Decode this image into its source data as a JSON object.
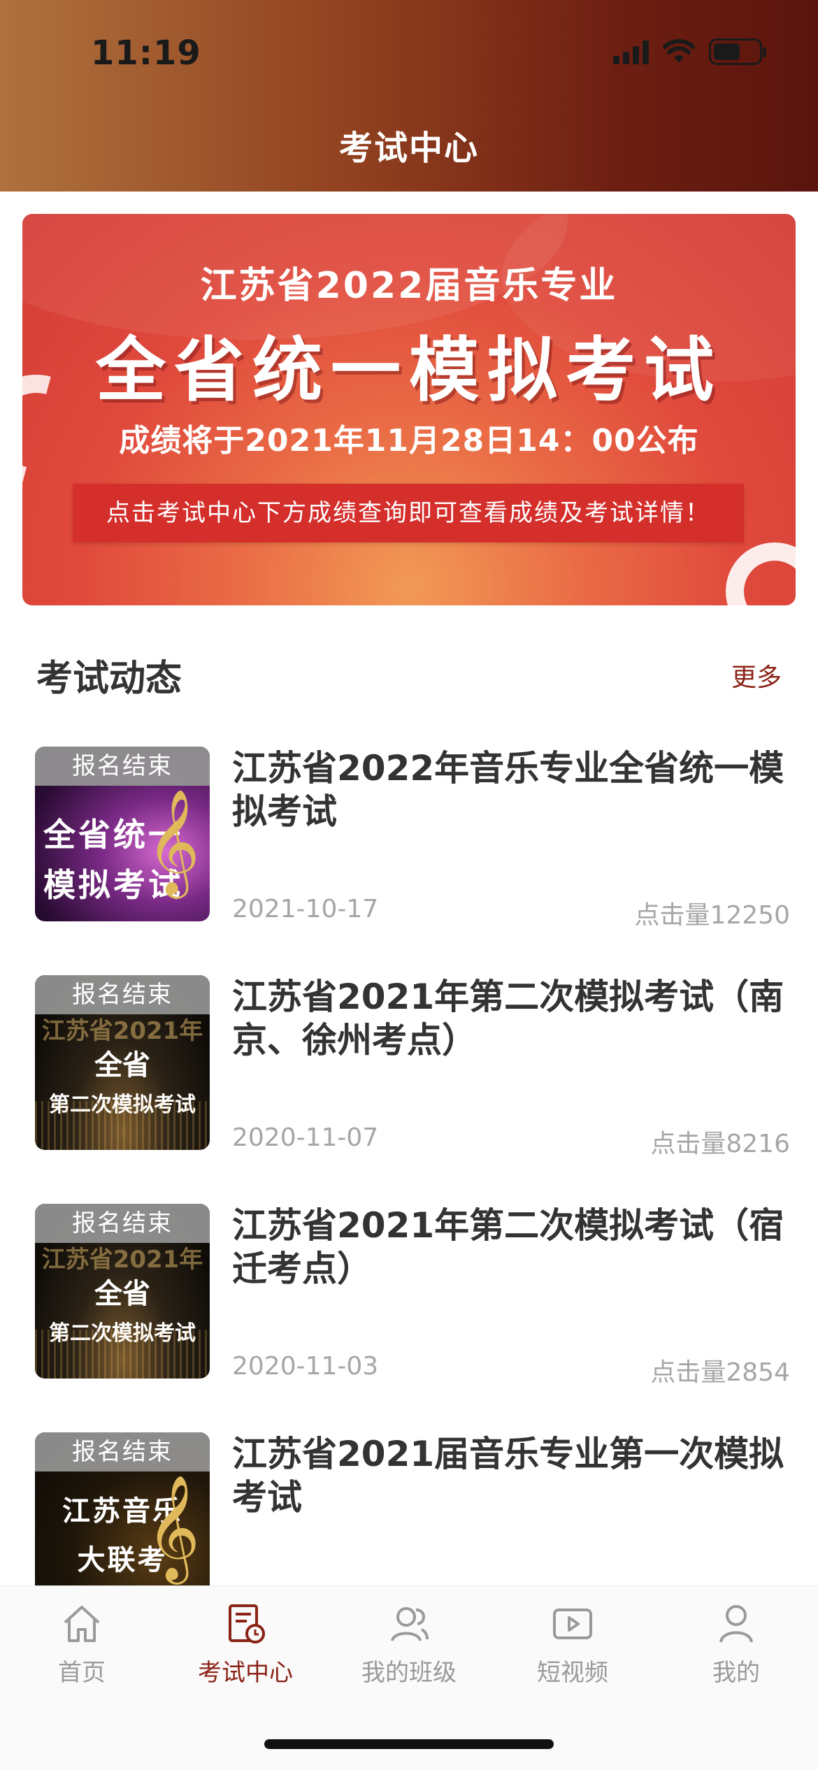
{
  "status_bar": {
    "time": "11:19"
  },
  "header": {
    "title": "考试中心"
  },
  "banner": {
    "line1": "江苏省2022届音乐专业",
    "line2": "全省统一模拟考试",
    "line3": "成绩将于2021年11月28日14：00公布",
    "note": "点击考试中心下方成绩查询即可查看成绩及考试详情！"
  },
  "section": {
    "title": "考试动态",
    "more": "更多"
  },
  "items": [
    {
      "badge": "报名结束",
      "thumb_lines": [
        "全省统一",
        "模拟考试"
      ],
      "title": "江苏省2022年音乐专业全省统一模拟考试",
      "date": "2021-10-17",
      "clicks": "点击量12250"
    },
    {
      "badge": "报名结束",
      "thumb_lines": [
        "江苏省2021年",
        "全省",
        "第二次模拟考试"
      ],
      "title": "江苏省2021年第二次模拟考试（南京、徐州考点）",
      "date": "2020-11-07",
      "clicks": "点击量8216"
    },
    {
      "badge": "报名结束",
      "thumb_lines": [
        "江苏省2021年",
        "全省",
        "第二次模拟考试"
      ],
      "title": "江苏省2021年第二次模拟考试（宿迁考点）",
      "date": "2020-11-03",
      "clicks": "点击量2854"
    },
    {
      "badge": "报名结束",
      "thumb_lines": [
        "江苏音乐",
        "大联考"
      ],
      "title": "江苏省2021届音乐专业第一次模拟考试",
      "date": "",
      "clicks": ""
    }
  ],
  "tabbar": {
    "tabs": [
      {
        "label": "首页",
        "icon": "home-icon",
        "active": false
      },
      {
        "label": "考试中心",
        "icon": "exam-center-icon",
        "active": true
      },
      {
        "label": "我的班级",
        "icon": "class-icon",
        "active": false
      },
      {
        "label": "短视频",
        "icon": "video-icon",
        "active": false
      },
      {
        "label": "我的",
        "icon": "profile-icon",
        "active": false
      }
    ]
  },
  "colors": {
    "accent": "#8b2317",
    "banner_red": "#d33b35",
    "muted_text": "#a6a6a6"
  }
}
